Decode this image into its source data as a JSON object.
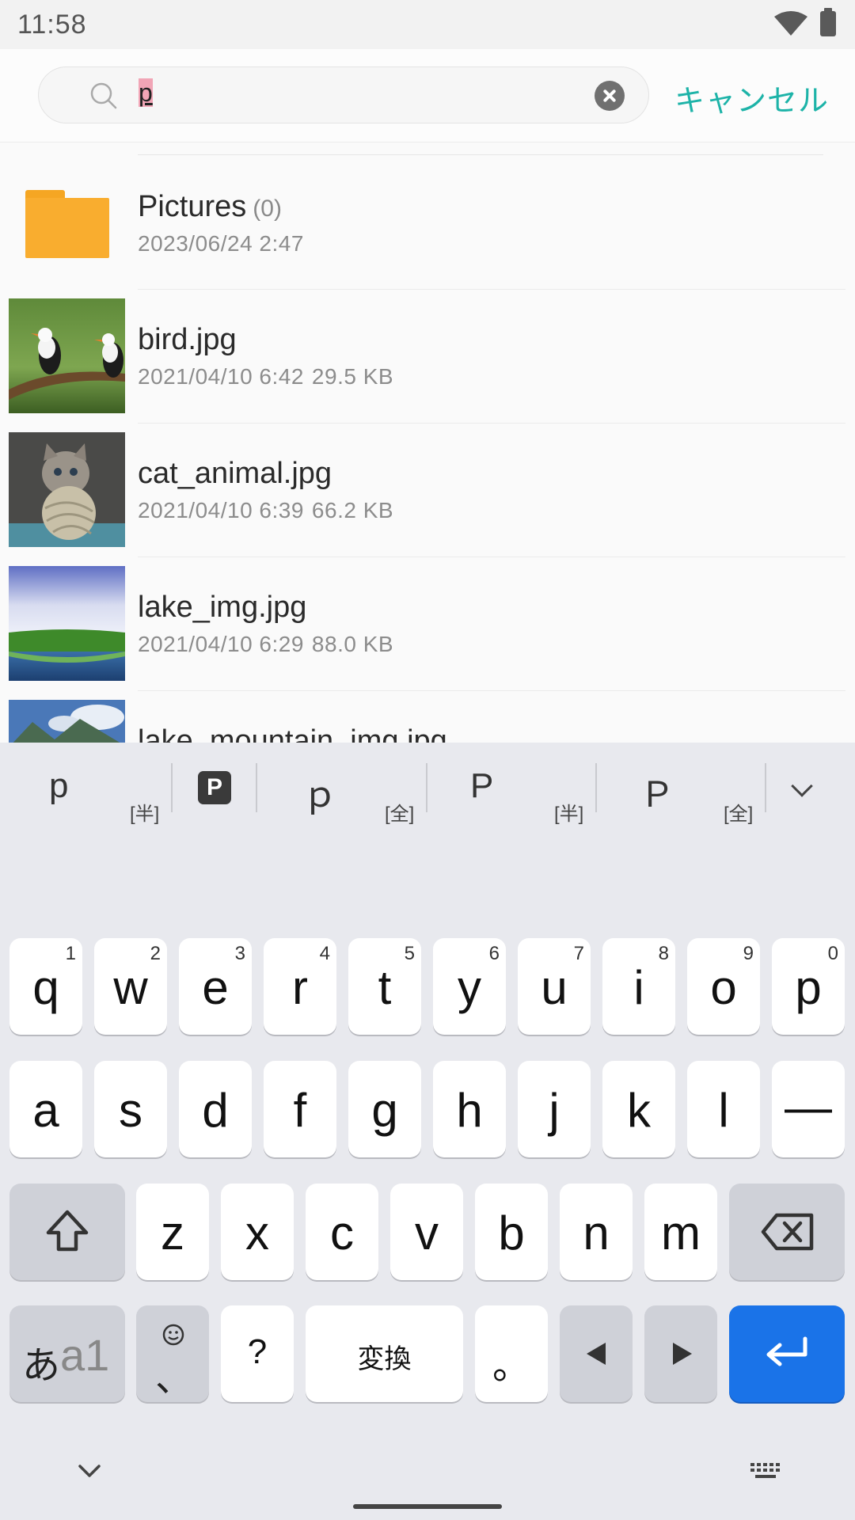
{
  "status_bar": {
    "time": "11:58",
    "wifi_icon": "wifi-icon",
    "battery_icon": "battery-icon"
  },
  "search": {
    "query": "p",
    "cancel_label": "キャンセル",
    "search_icon": "search-icon",
    "clear_icon": "clear-icon"
  },
  "files": [
    {
      "name": "Pictures",
      "count": "(0)",
      "date": "2023/06/24 2:47",
      "size": "",
      "icon": "folder-icon"
    },
    {
      "name": "bird.jpg",
      "date": "2021/04/10 6:42",
      "size": "29.5 KB",
      "icon": "bird-thumbnail"
    },
    {
      "name": "cat_animal.jpg",
      "date": "2021/04/10 6:39",
      "size": "66.2 KB",
      "icon": "cat-thumbnail"
    },
    {
      "name": "lake_img.jpg",
      "date": "2021/04/10 6:29",
      "size": "88.0 KB",
      "icon": "lake-thumbnail"
    },
    {
      "name": "lake_mountain_img.jpg",
      "date": "",
      "size": "",
      "icon": "mountain-thumbnail"
    }
  ],
  "keyboard": {
    "suggestions": [
      {
        "text": "p",
        "tag": "[半]"
      },
      {
        "text": "P",
        "tag": ""
      },
      {
        "text": "ｐ",
        "tag": "[全]"
      },
      {
        "text": "P",
        "tag": "[半]"
      },
      {
        "text": "Ｐ",
        "tag": "[全]"
      }
    ],
    "row1": [
      {
        "key": "q",
        "num": "1"
      },
      {
        "key": "w",
        "num": "2"
      },
      {
        "key": "e",
        "num": "3"
      },
      {
        "key": "r",
        "num": "4"
      },
      {
        "key": "t",
        "num": "5"
      },
      {
        "key": "y",
        "num": "6"
      },
      {
        "key": "u",
        "num": "7"
      },
      {
        "key": "i",
        "num": "8"
      },
      {
        "key": "o",
        "num": "9"
      },
      {
        "key": "p",
        "num": "0"
      }
    ],
    "row2": [
      "a",
      "s",
      "d",
      "f",
      "g",
      "h",
      "j",
      "k",
      "l",
      "—"
    ],
    "row3": [
      "z",
      "x",
      "c",
      "v",
      "b",
      "n",
      "m"
    ],
    "bottom_row": {
      "mode": "あ",
      "mode_alt": "a1",
      "emoji_comma": "、",
      "question": "?",
      "convert": "変換",
      "period": "。"
    },
    "enter_color": "#1a73e8"
  },
  "colors": {
    "accent": "#1db3a8",
    "folder": "#f9ad2f"
  }
}
